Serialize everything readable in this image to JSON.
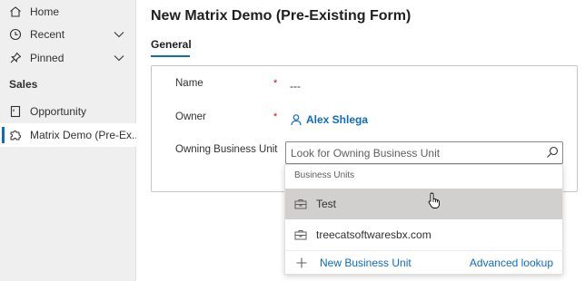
{
  "sidebar": {
    "items": [
      {
        "label": "Home",
        "icon": "home-icon"
      },
      {
        "label": "Recent",
        "icon": "clock-icon",
        "chevron": "chevron-down-icon"
      },
      {
        "label": "Pinned",
        "icon": "pin-icon",
        "chevron": "chevron-down-icon"
      }
    ],
    "section_label": "Sales",
    "section_items": [
      {
        "label": "Opportunity",
        "icon": "document-icon"
      },
      {
        "label": "Matrix Demo (Pre-Ex...",
        "icon": "puzzle-icon",
        "active": true
      }
    ]
  },
  "page": {
    "title": "New Matrix Demo (Pre-Existing Form)",
    "tabs": [
      {
        "label": "General",
        "selected": true
      }
    ]
  },
  "form": {
    "fields": [
      {
        "label": "Name",
        "required_mark": "*",
        "value": "---"
      },
      {
        "label": "Owner",
        "required_mark": "*",
        "value": "Alex Shlega"
      },
      {
        "label": "Owning Business Unit",
        "placeholder": "Look for Owning Business Unit",
        "value": ""
      }
    ]
  },
  "lookup_dropdown": {
    "header": "Business Units",
    "items": [
      {
        "label": "Test",
        "icon": "business-unit-icon",
        "hovered": true
      },
      {
        "label": "treecatsoftwaresbx.com",
        "icon": "business-unit-icon"
      }
    ],
    "new_label": "New Business Unit",
    "advanced_label": "Advanced lookup"
  },
  "colors": {
    "accent": "#0f6cbd",
    "required": "#c50f1f",
    "sidebar_bg": "#efefef",
    "hover_bg": "#d2d0ce"
  }
}
